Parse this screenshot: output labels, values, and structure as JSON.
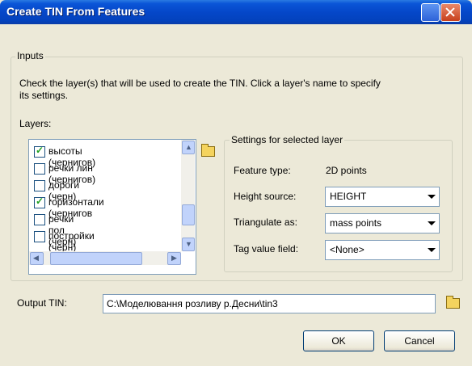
{
  "title": "Create TIN From Features",
  "inputs": {
    "legend": "Inputs",
    "instructions_line1": "Check the layer(s) that will be used to create the TIN.  Click a layer's name to specify",
    "instructions_line2": "its settings.",
    "layers_label": "Layers:",
    "layers": [
      {
        "label": "высоты (чернигов)",
        "checked": true
      },
      {
        "label": "речки лин (чернигов)",
        "checked": false
      },
      {
        "label": "дороги (черн)",
        "checked": false
      },
      {
        "label": "горизонтали (чернигов",
        "checked": true
      },
      {
        "label": "речки пол (черн)",
        "checked": false
      },
      {
        "label": "постройки (черн)",
        "checked": false
      }
    ]
  },
  "settings": {
    "legend": "Settings for selected layer",
    "feature_type_label": "Feature type:",
    "feature_type_value": "2D points",
    "height_source_label": "Height source:",
    "height_source_value": "HEIGHT",
    "triangulate_label": "Triangulate as:",
    "triangulate_value": "mass points",
    "tag_label": "Tag value field:",
    "tag_value": "<None>"
  },
  "output": {
    "label": "Output TIN:",
    "value": "C:\\Моделювання розливу р.Десни\\tin3"
  },
  "buttons": {
    "ok": "OK",
    "cancel": "Cancel"
  },
  "icons": {
    "open_layers": "folder-open-icon",
    "open_output": "folder-open-icon",
    "scroll_up": "arrow-up-icon",
    "scroll_down": "arrow-down-icon",
    "scroll_left": "arrow-left-icon",
    "scroll_right": "arrow-right-icon"
  }
}
